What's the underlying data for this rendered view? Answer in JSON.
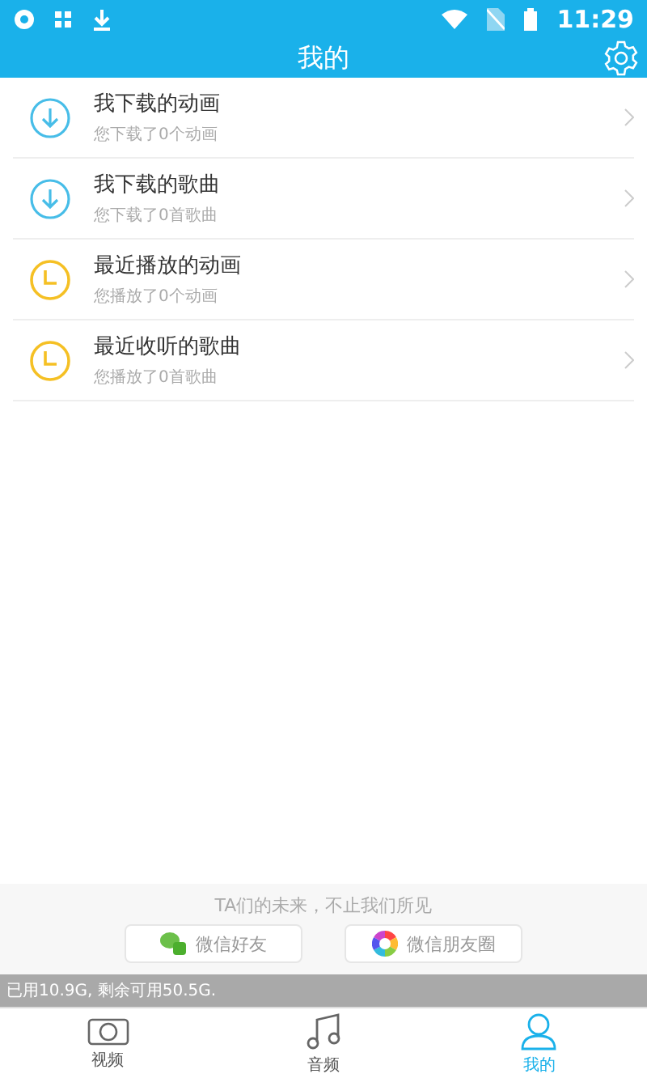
{
  "status_bar": {
    "time": "11:29"
  },
  "header": {
    "title": "我的"
  },
  "items": [
    {
      "kind": "download",
      "title": "我下载的动画",
      "subtitle": "您下载了0个动画"
    },
    {
      "kind": "download",
      "title": "我下载的歌曲",
      "subtitle": "您下载了0首歌曲"
    },
    {
      "kind": "history",
      "title": "最近播放的动画",
      "subtitle": "您播放了0个动画"
    },
    {
      "kind": "history",
      "title": "最近收听的歌曲",
      "subtitle": "您播放了0首歌曲"
    }
  ],
  "share": {
    "slogan": "TA们的未来，不止我们所见",
    "buttons": [
      {
        "kind": "friend",
        "label": "微信好友"
      },
      {
        "kind": "moments",
        "label": "微信朋友圈"
      }
    ]
  },
  "storage": {
    "text": "已用10.9G, 剩余可用50.5G."
  },
  "tabs": [
    {
      "kind": "video",
      "label": "视频",
      "selected": false
    },
    {
      "kind": "audio",
      "label": "音频",
      "selected": false
    },
    {
      "kind": "me",
      "label": "我的",
      "selected": true
    }
  ]
}
